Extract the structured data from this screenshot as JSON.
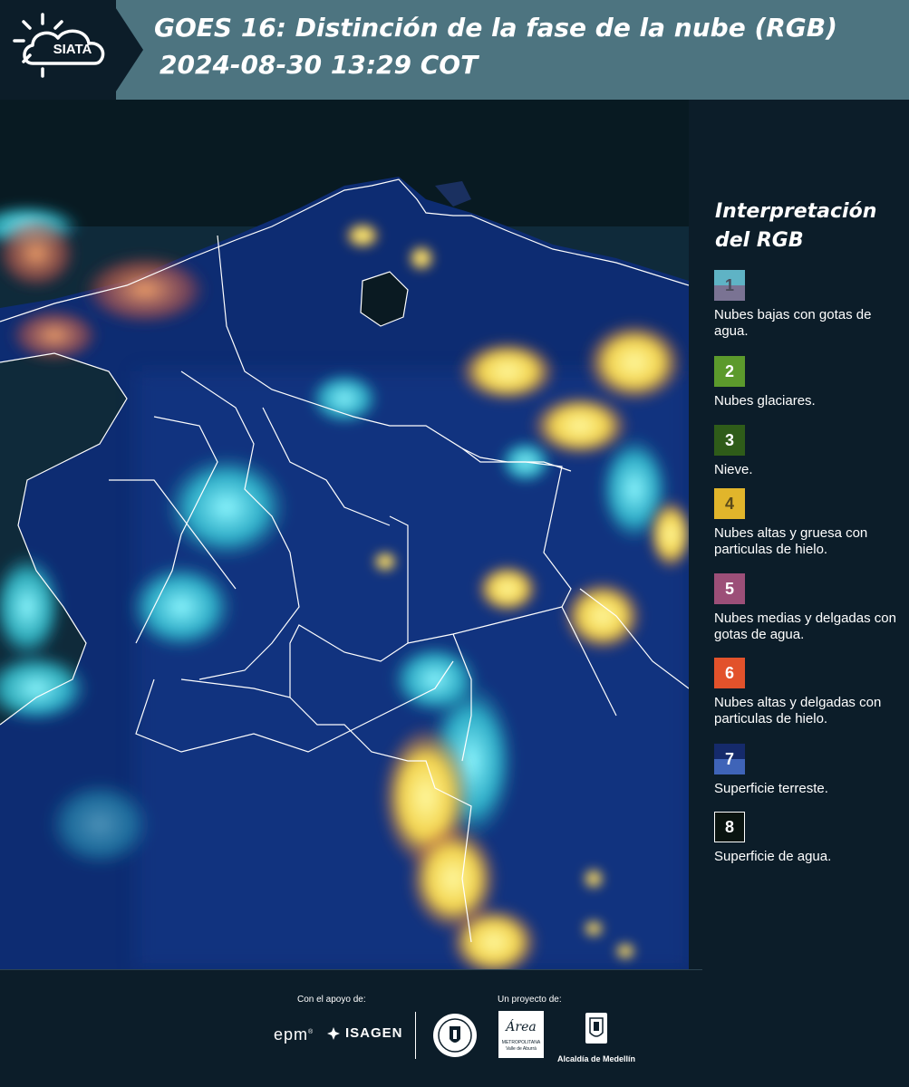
{
  "header": {
    "logo_text": "SIATA",
    "title_line1": "GOES 16: Distinción de la fase de la nube (RGB)",
    "title_line2": "2024-08-30 13:29 COT"
  },
  "legend": {
    "title": "Interpretación del RGB",
    "items": [
      {
        "number": "1",
        "label": "Nubes bajas con gotas de agua.",
        "color_top": "#5fb3c5",
        "color_bottom": "#7a7393",
        "number_color": "#4b4b5a"
      },
      {
        "number": "2",
        "label": "Nubes glaciares.",
        "color_top": "#5c9a2c",
        "color_bottom": "#5c9a2c",
        "number_color": "#ffffff"
      },
      {
        "number": "3",
        "label": "Nieve.",
        "color_top": "#2f5c19",
        "color_bottom": "#2f5c19",
        "number_color": "#ffffff"
      },
      {
        "number": "4",
        "label": "Nubes altas y gruesa con particulas de hielo.",
        "color_top": "#e1b52b",
        "color_bottom": "#e1b52b",
        "number_color": "#5a4a1a"
      },
      {
        "number": "5",
        "label": "Nubes medias y delgadas con gotas de agua.",
        "color_top": "#9c4f78",
        "color_bottom": "#9c4f78",
        "number_color": "#ffffff"
      },
      {
        "number": "6",
        "label": "Nubes altas y delgadas con particulas de hielo.",
        "color_top": "#e2522b",
        "color_bottom": "#e2522b",
        "number_color": "#ffffff"
      },
      {
        "number": "7",
        "label": "Superficie terreste.",
        "color_top": "#152a6b",
        "color_bottom": "#3f64b8",
        "number_color": "#ffffff"
      },
      {
        "number": "8",
        "label": "Superficie de agua.",
        "color_top": "#0a1410",
        "color_bottom": "#0a1410",
        "number_color": "#ffffff"
      }
    ]
  },
  "footer": {
    "support_label": "Con el apoyo de:",
    "project_label": "Un proyecto de:",
    "sponsor_epm": "epm",
    "sponsor_isagen": "ISAGEN",
    "area_logo_text": "Área",
    "area_logo_sub": "METROPOLITANA",
    "area_logo_sub2": "Valle de Aburrá",
    "alcaldia": "Alcaldía de Medellín"
  },
  "colors": {
    "header_band": "#4d7480",
    "background": "#0c1d29",
    "ocean": "#0f2533",
    "land": "#0d2a6b",
    "cloud_high": "#f2d85a",
    "cloud_low": "#59e0e0"
  }
}
